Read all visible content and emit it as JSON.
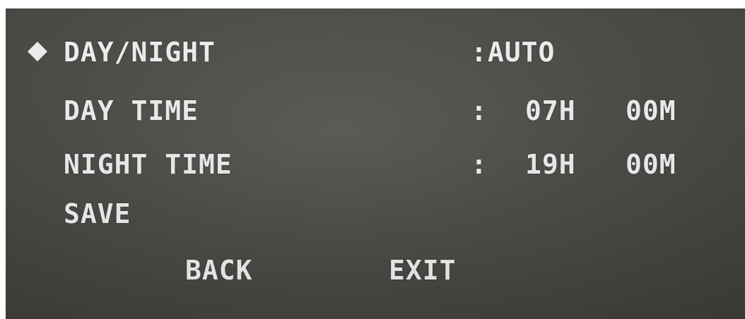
{
  "menu": {
    "cursor_icon": "diamond-icon",
    "rows": [
      {
        "label": "DAY/NIGHT",
        "value": ":AUTO"
      },
      {
        "label": "DAY TIME",
        "sep": ":",
        "hour": "07H",
        "minute": "00M"
      },
      {
        "label": "NIGHT TIME",
        "sep": ":",
        "hour": "19H",
        "minute": "00M"
      },
      {
        "label": "SAVE"
      }
    ],
    "back_label": "BACK",
    "exit_label": "EXIT"
  },
  "colors": {
    "text": "#ececec",
    "background": "#4b4a46"
  }
}
